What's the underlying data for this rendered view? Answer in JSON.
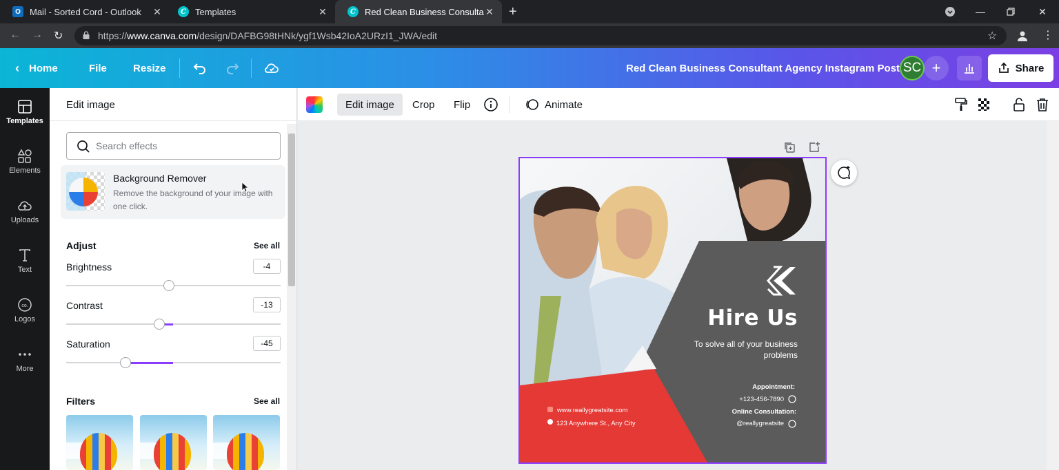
{
  "browser": {
    "tabs": [
      {
        "label": "Mail - Sorted Cord - Outlook",
        "icon": "outlook-icon"
      },
      {
        "label": "Templates",
        "icon": "canva-icon"
      },
      {
        "label": "Red Clean Business Consultant /",
        "icon": "canva-icon"
      }
    ],
    "url_prefix": "https://",
    "url_domain": "www.canva.com",
    "url_path": "/design/DAFBG98tHNk/ygf1Wsb42IoA2URzI1_JWA/edit"
  },
  "header": {
    "home": "Home",
    "file": "File",
    "resize": "Resize",
    "doc_title": "Red Clean Business Consultant Agency Instagram Post",
    "avatar_initials": "SC",
    "share": "Share",
    "gradient_colors": [
      "#0bb5d6",
      "#2b8fe6",
      "#5a55e8",
      "#7b3fe4"
    ]
  },
  "rail": {
    "items": [
      {
        "label": "Templates",
        "icon": "templates-icon"
      },
      {
        "label": "Elements",
        "icon": "elements-icon"
      },
      {
        "label": "Uploads",
        "icon": "uploads-icon"
      },
      {
        "label": "Text",
        "icon": "text-icon"
      },
      {
        "label": "Logos",
        "icon": "logos-icon"
      },
      {
        "label": "More",
        "icon": "more-icon"
      }
    ]
  },
  "panel": {
    "title": "Edit image",
    "search_placeholder": "Search effects",
    "bg_remover": {
      "title": "Background Remover",
      "desc": "Remove the background of your image with one click."
    },
    "adjust": {
      "title": "Adjust",
      "see_all": "See all",
      "sliders": [
        {
          "label": "Brightness",
          "value": "-4"
        },
        {
          "label": "Contrast",
          "value": "-13"
        },
        {
          "label": "Saturation",
          "value": "-45"
        }
      ]
    },
    "filters": {
      "title": "Filters",
      "see_all": "See all"
    }
  },
  "toolbar": {
    "edit_image": "Edit image",
    "crop": "Crop",
    "flip": "Flip",
    "animate": "Animate"
  },
  "design": {
    "title": "Hire Us",
    "subtitle": "To solve all of your business problems",
    "website": "www.reallygreatsite.com",
    "address": "123 Anywhere St., Any City",
    "appointment_label": "Appointment:",
    "phone": "+123-456-7890",
    "online_label": "Online Consultation:",
    "handle": "@reallygreatsite",
    "colors": {
      "red": "#e53935",
      "gray": "#5b5b5b",
      "accent": "#8b3dff"
    }
  }
}
